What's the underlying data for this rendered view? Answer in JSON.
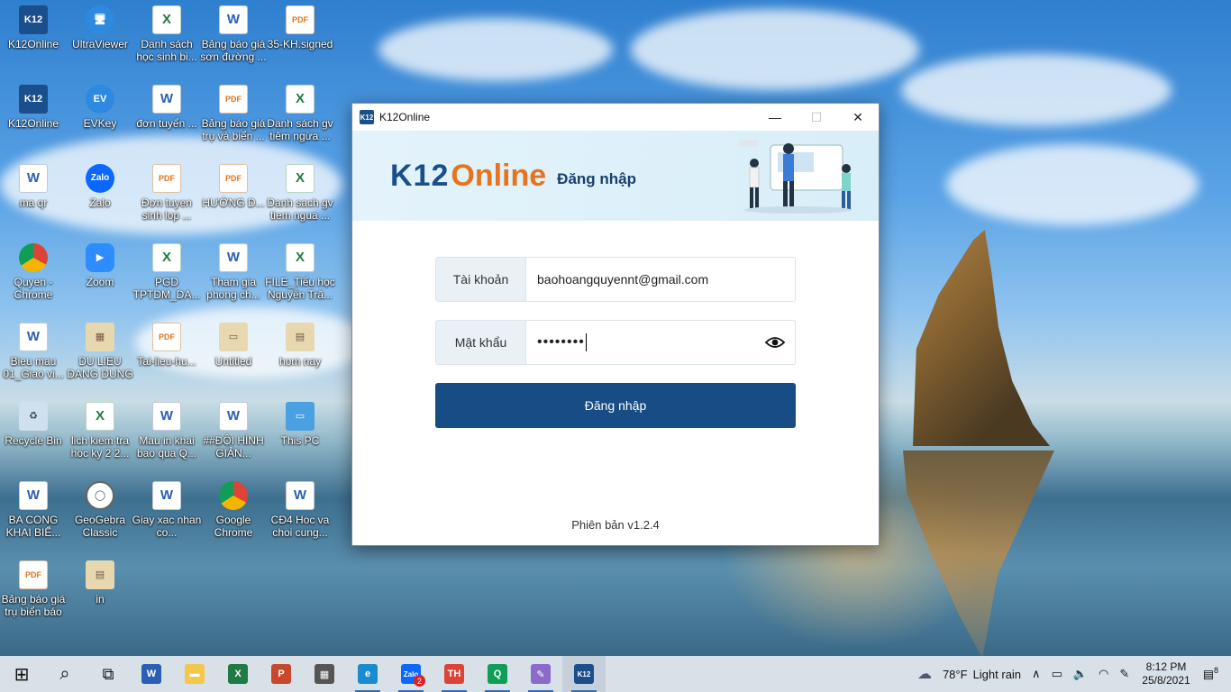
{
  "desktop": {
    "icons": [
      {
        "label": "K12Online",
        "glyph": "K12",
        "type": "k12"
      },
      {
        "label": "UltraViewer",
        "glyph": "🖥",
        "type": "app"
      },
      {
        "label": "Danh sách học sinh bi...",
        "glyph": "X",
        "type": "excel"
      },
      {
        "label": "Bảng báo giá sơn đường ...",
        "glyph": "W",
        "type": "word"
      },
      {
        "label": "35-KH.signed",
        "glyph": "PDF",
        "type": "pdf"
      },
      {
        "label": "K12Online",
        "glyph": "K12",
        "type": "k12"
      },
      {
        "label": "EVKey",
        "glyph": "EV",
        "type": "app"
      },
      {
        "label": "đơn tuyển ...",
        "glyph": "W",
        "type": "word"
      },
      {
        "label": "Bảng báo giá trụ và biển ...",
        "glyph": "PDF",
        "type": "pdf"
      },
      {
        "label": "Danh sách gv tiêm ngừa ...",
        "glyph": "X",
        "type": "excel"
      },
      {
        "label": "ma qr",
        "glyph": "W",
        "type": "word"
      },
      {
        "label": "Zalo",
        "glyph": "Zalo",
        "type": "zalo"
      },
      {
        "label": "Đơn tuyen sinh lop ...",
        "glyph": "PDF",
        "type": "pdf"
      },
      {
        "label": "HƯỚNG D...",
        "glyph": "PDF",
        "type": "pdf"
      },
      {
        "label": "Danh sach gv tiem ngua ...",
        "glyph": "X",
        "type": "excel"
      },
      {
        "label": "Quyen - Chrome",
        "glyph": "",
        "type": "chrome"
      },
      {
        "label": "Zoom",
        "glyph": "▶",
        "type": "zoom"
      },
      {
        "label": "PGD TPTDM_DA...",
        "glyph": "X",
        "type": "excel"
      },
      {
        "label": "Tham gia phong ch...",
        "glyph": "W",
        "type": "word"
      },
      {
        "label": "FILE_Tiểu học Nguyễn Trã...",
        "glyph": "X",
        "type": "excel"
      },
      {
        "label": "Bieu mau 01_Giao vi...",
        "glyph": "W",
        "type": "word"
      },
      {
        "label": "DU LIEU DANG DUNG",
        "glyph": "▦",
        "type": "img"
      },
      {
        "label": "Tai-lieu-hu...",
        "glyph": "PDF",
        "type": "pdf"
      },
      {
        "label": "Untitled",
        "glyph": "▭",
        "type": "img"
      },
      {
        "label": "hom nay",
        "glyph": "▤",
        "type": "img"
      },
      {
        "label": "Recycle Bin",
        "glyph": "♻",
        "type": "bin"
      },
      {
        "label": "lich kiem tra hoc ky 2 2...",
        "glyph": "X",
        "type": "excel"
      },
      {
        "label": "Mau in khai bao qua Q...",
        "glyph": "W",
        "type": "word"
      },
      {
        "label": "##ĐỘI HÌNH GIẢN...",
        "glyph": "W",
        "type": "word"
      },
      {
        "label": "This PC",
        "glyph": "▭",
        "type": "pc"
      },
      {
        "label": "BA CONG KHAI BIỂ...",
        "glyph": "W",
        "type": "word"
      },
      {
        "label": "GeoGebra Classic",
        "glyph": "◯",
        "type": "geo"
      },
      {
        "label": "Giay xac nhan co...",
        "glyph": "W",
        "type": "word"
      },
      {
        "label": "Google Chrome",
        "glyph": "",
        "type": "chrome"
      },
      {
        "label": "CĐ4 Hoc va choi cung...",
        "glyph": "W",
        "type": "word"
      },
      {
        "label": "Bảng báo giá trụ biển báo",
        "glyph": "PDF",
        "type": "pdf"
      },
      {
        "label": "in",
        "glyph": "▤",
        "type": "img"
      }
    ]
  },
  "window": {
    "title": "K12Online",
    "logo_small": "K12",
    "minimize": "—",
    "maximize": "☐",
    "close": "✕",
    "banner": {
      "brand_k12": "K12",
      "brand_online": "Online",
      "subtitle": "Đăng nhập"
    },
    "username_label": "Tài khoản",
    "username_value": "baohoangquyennt@gmail.com",
    "password_label": "Mật khẩu",
    "password_value": "••••••••",
    "login_button": "Đăng nhập",
    "version": "Phiên bản v1.2.4"
  },
  "taskbar": {
    "start": "⊞",
    "search": "⌕",
    "taskview": "⧉",
    "apps": [
      {
        "name": "word",
        "glyph": "W",
        "color": "#2b5fb4"
      },
      {
        "name": "explorer",
        "glyph": "▬",
        "color": "#f3c84a"
      },
      {
        "name": "excel",
        "glyph": "X",
        "color": "#1f7a44"
      },
      {
        "name": "powerpoint",
        "glyph": "P",
        "color": "#c9472a"
      },
      {
        "name": "store",
        "glyph": "▦",
        "color": "#555555"
      },
      {
        "name": "edge",
        "glyph": "e",
        "color": "#1a8bd0"
      },
      {
        "name": "zalo",
        "glyph": "Zalo",
        "color": "#0a68ff"
      },
      {
        "name": "chrome-th",
        "glyph": "TH",
        "color": "#db4437"
      },
      {
        "name": "chrome-q",
        "glyph": "Q",
        "color": "#0f9d58"
      },
      {
        "name": "paint",
        "glyph": "✎",
        "color": "#8a6acb"
      },
      {
        "name": "k12online",
        "glyph": "K12",
        "color": "#1a4f8b"
      }
    ],
    "zalo_badge": "2",
    "weather_temp": "78°F",
    "weather_text": "Light rain",
    "time": "8:12 PM",
    "date": "25/8/2021",
    "notification_count": "8"
  }
}
